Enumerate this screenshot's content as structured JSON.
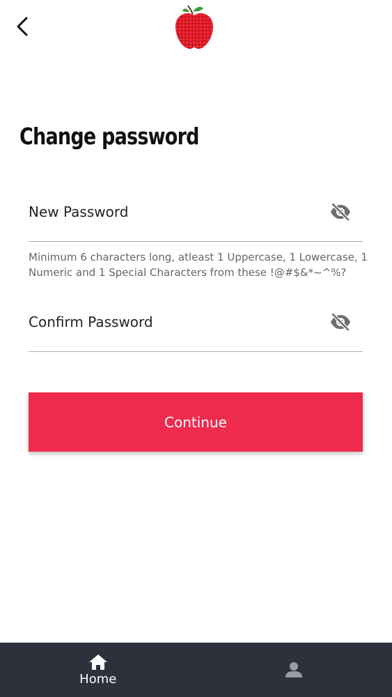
{
  "header": {
    "back_icon": "chevron-left-icon",
    "logo_icon": "apple-logo-icon",
    "logo_color": "#e01e2a"
  },
  "page": {
    "title": "Change password"
  },
  "form": {
    "new_password": {
      "placeholder": "New Password",
      "value": "",
      "toggle_icon": "eye-off-icon"
    },
    "hint": "Minimum 6 characters long, atleast 1 Uppercase, 1 Lowercase, 1 Numeric and 1 Special Characters from these !@#$&*~^%?",
    "confirm_password": {
      "placeholder": "Confirm Password",
      "value": "",
      "toggle_icon": "eye-off-icon"
    },
    "submit_label": "Continue"
  },
  "bottom_nav": {
    "items": [
      {
        "label": "Home",
        "icon": "home-icon",
        "active": true
      },
      {
        "label": "",
        "icon": "user-icon",
        "active": false
      }
    ]
  },
  "colors": {
    "accent": "#ee2b4d",
    "nav_background": "#2c313b",
    "nav_active": "#ffffff",
    "nav_inactive": "#9a9da3",
    "icon_gray": "#6e6e6e"
  }
}
